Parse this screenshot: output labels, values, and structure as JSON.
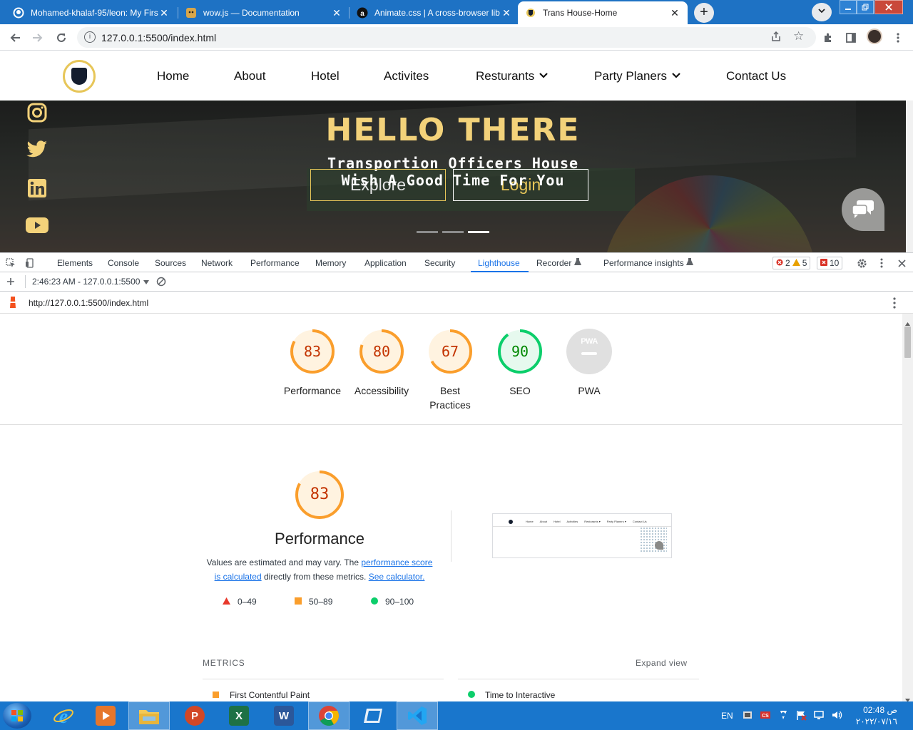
{
  "browser": {
    "tabs": [
      {
        "title": "Mohamed-khalaf-95/leon: My First",
        "icon": "github-icon"
      },
      {
        "title": "wow.js — Documentation",
        "icon": "doge-icon"
      },
      {
        "title": "Animate.css | A cross-browser lib",
        "icon": "animate-icon"
      },
      {
        "title": "Trans House-Home",
        "icon": "shield-icon",
        "active": true
      }
    ],
    "close_glyph": "✕",
    "new_tab_glyph": "+",
    "url": "127.0.0.1:5500/index.html"
  },
  "site": {
    "nav": [
      "Home",
      "About",
      "Hotel",
      "Activites",
      "Resturants",
      "Party Planers",
      "Contact Us"
    ],
    "hero": {
      "title": "HELLO THERE",
      "subtitle_line1": "Transportion Officers House",
      "subtitle_line2": "Wish A Good Time For You",
      "explore_label": "Explore",
      "login_label": "Login",
      "carousel_active_index": 2
    },
    "social": [
      "instagram-icon",
      "twitter-icon",
      "linkedin-icon",
      "youtube-icon"
    ]
  },
  "devtools": {
    "tabs": [
      "Elements",
      "Console",
      "Sources",
      "Network",
      "Performance",
      "Memory",
      "Application",
      "Security",
      "Lighthouse",
      "Recorder",
      "Performance insights"
    ],
    "active_tab": "Lighthouse",
    "badges": {
      "errors": "2",
      "warnings": "5",
      "issues": "10"
    },
    "report_selector": "2:46:23 AM - 127.0.0.1:5500",
    "report_url": "http://127.0.0.1:5500/index.html",
    "scores": [
      {
        "label": "Performance",
        "value": "83",
        "score": 83
      },
      {
        "label": "Accessibility",
        "value": "80",
        "score": 80
      },
      {
        "label": "Best Practices",
        "value": "67",
        "score": 67
      },
      {
        "label": "SEO",
        "value": "90",
        "score": 90
      },
      {
        "label": "PWA",
        "value": "",
        "score": 0
      }
    ],
    "pwa_badge": "PWA",
    "performance": {
      "score": "83",
      "title": "Performance",
      "desc_prefix": "Values are estimated and may vary. The ",
      "desc_link1": "performance score is calculated",
      "desc_mid": " directly from these metrics. ",
      "desc_link2": "See calculator.",
      "legend": [
        {
          "range": "0–49",
          "color": "#e8382b"
        },
        {
          "range": "50–89",
          "color": "#fa9e2c"
        },
        {
          "range": "90–100",
          "color": "#0cce6b"
        }
      ]
    },
    "thumb_nav": [
      "Home",
      "About",
      "Hotel",
      "Activities",
      "Resturants ▾",
      "Party Planers ▾",
      "Contact Us"
    ],
    "metrics_heading": "METRICS",
    "expand_label": "Expand view",
    "metrics": [
      {
        "name": "First Contentful Paint",
        "status": "average"
      },
      {
        "name": "Time to Interactive",
        "status": "pass"
      }
    ]
  },
  "colors": {
    "chrome_blue": "#1e72c4",
    "gold": "#f3d27a",
    "average": "#fa9e2c",
    "average_text": "#c33300",
    "pass": "#0cce6b",
    "pass_text": "#008800",
    "link": "#1a73e8"
  },
  "taskbar": {
    "apps": [
      "ie-icon",
      "media-player-icon",
      "file-explorer-icon",
      "powerpoint-icon",
      "excel-icon",
      "word-icon",
      "chrome-icon",
      "remote-desktop-icon",
      "vscode-icon"
    ],
    "language": "EN",
    "time": "02:48 ص",
    "date": "٢٠٢٢/٠٧/١٦"
  }
}
